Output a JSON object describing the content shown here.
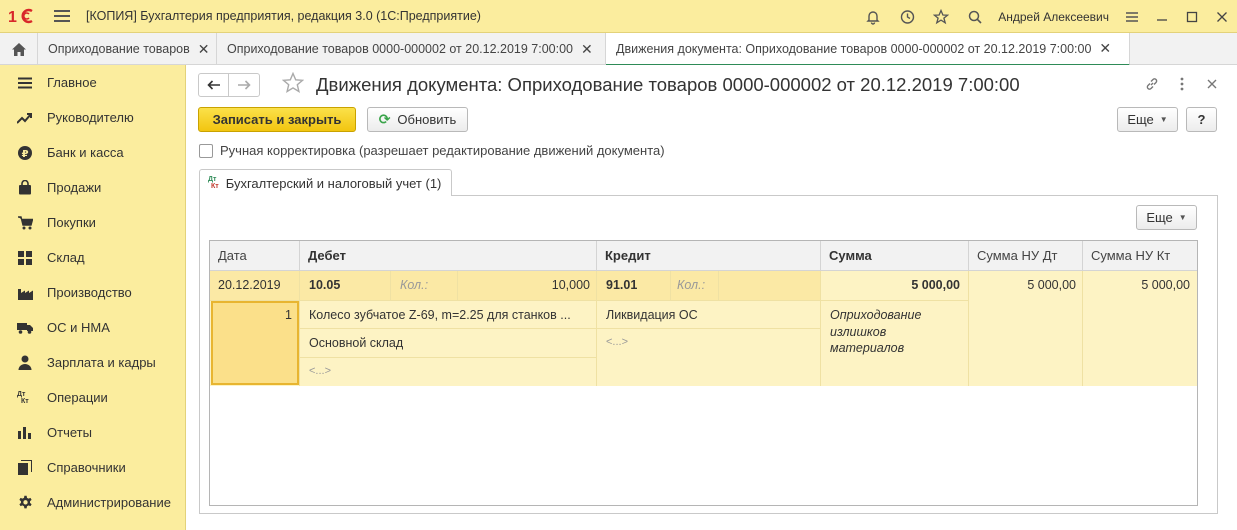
{
  "app": {
    "title": "[КОПИЯ] Бухгалтерия предприятия, редакция 3.0  (1С:Предприятие)",
    "user": "Андрей Алексеевич",
    "accent": "#fbed9e"
  },
  "tabs": [
    {
      "label": "Оприходование товаров"
    },
    {
      "label": "Оприходование товаров 0000-000002 от 20.12.2019 7:00:00"
    },
    {
      "label": "Движения документа: Оприходование товаров 0000-000002 от 20.12.2019 7:00:00"
    }
  ],
  "sidebar": {
    "items": [
      {
        "label": "Главное",
        "icon": "list-icon"
      },
      {
        "label": "Руководителю",
        "icon": "trend-icon"
      },
      {
        "label": "Банк и касса",
        "icon": "ruble-icon"
      },
      {
        "label": "Продажи",
        "icon": "bag-icon"
      },
      {
        "label": "Покупки",
        "icon": "cart-icon"
      },
      {
        "label": "Склад",
        "icon": "warehouse-icon"
      },
      {
        "label": "Производство",
        "icon": "factory-icon"
      },
      {
        "label": "ОС и НМА",
        "icon": "truck-icon"
      },
      {
        "label": "Зарплата и кадры",
        "icon": "person-icon"
      },
      {
        "label": "Операции",
        "icon": "dt-kt-icon"
      },
      {
        "label": "Отчеты",
        "icon": "bar-chart-icon"
      },
      {
        "label": "Справочники",
        "icon": "books-icon"
      },
      {
        "label": "Администрирование",
        "icon": "gear-icon"
      }
    ]
  },
  "document": {
    "title": "Движения документа: Оприходование товаров 0000-000002 от 20.12.2019 7:00:00",
    "save_close": "Записать и закрыть",
    "refresh": "Обновить",
    "more": "Еще",
    "help": "?",
    "manual_checkbox": "Ручная корректировка (разрешает редактирование движений документа)",
    "page_tab": "Бухгалтерский и налоговый учет (1)",
    "dt": "Дт",
    "kt": "Кт"
  },
  "grid": {
    "headers": {
      "date": "Дата",
      "debit": "Дебет",
      "credit": "Кредит",
      "sum": "Сумма",
      "sum_nu_dt": "Сумма НУ Дт",
      "sum_nu_kt": "Сумма НУ Кт"
    },
    "row": {
      "date": "20.12.2019",
      "line_no": "1",
      "debit_account": "10.05",
      "debit_qty_label": "Кол.:",
      "debit_qty": "10,000",
      "debit_sub1": "Колесо зубчатое Z-69, m=2.25 для станков ...",
      "debit_sub2": "Основной склад",
      "debit_sub3": "<...>",
      "credit_account": "91.01",
      "credit_qty_label": "Кол.:",
      "credit_sub1": "Ликвидация ОС",
      "credit_sub2": "<...>",
      "sum": "5 000,00",
      "content": "Оприходование излишков материалов",
      "sum_nu_dt": "5 000,00",
      "sum_nu_kt": "5 000,00"
    }
  }
}
